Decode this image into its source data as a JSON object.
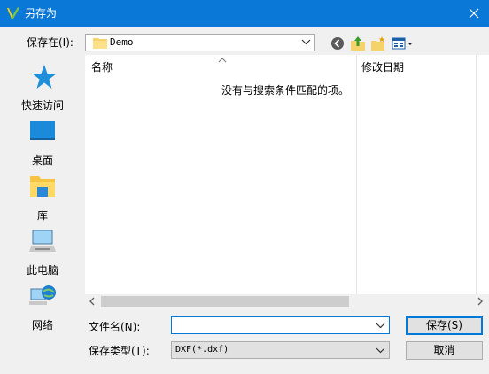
{
  "window": {
    "title": "另存为",
    "accent": "#0a78d7"
  },
  "toolbar": {
    "save_in_label": "保存在(I):",
    "location": "Demo",
    "icons": [
      "back-icon",
      "up-folder-icon",
      "new-folder-icon",
      "view-menu-icon"
    ]
  },
  "places": [
    {
      "label": "快速访问",
      "icon": "quick-access-icon"
    },
    {
      "label": "桌面",
      "icon": "desktop-icon"
    },
    {
      "label": "库",
      "icon": "library-icon"
    },
    {
      "label": "此电脑",
      "icon": "this-pc-icon"
    },
    {
      "label": "网络",
      "icon": "network-icon"
    }
  ],
  "file_list": {
    "columns": [
      "名称",
      "修改日期"
    ],
    "empty_message": "没有与搜索条件匹配的项。"
  },
  "form": {
    "filename_label": "文件名(N):",
    "filename_value": "",
    "filetype_label": "保存类型(T):",
    "filetype_value": "DXF(*.dxf)"
  },
  "buttons": {
    "save": "保存(S)",
    "cancel": "取消"
  }
}
